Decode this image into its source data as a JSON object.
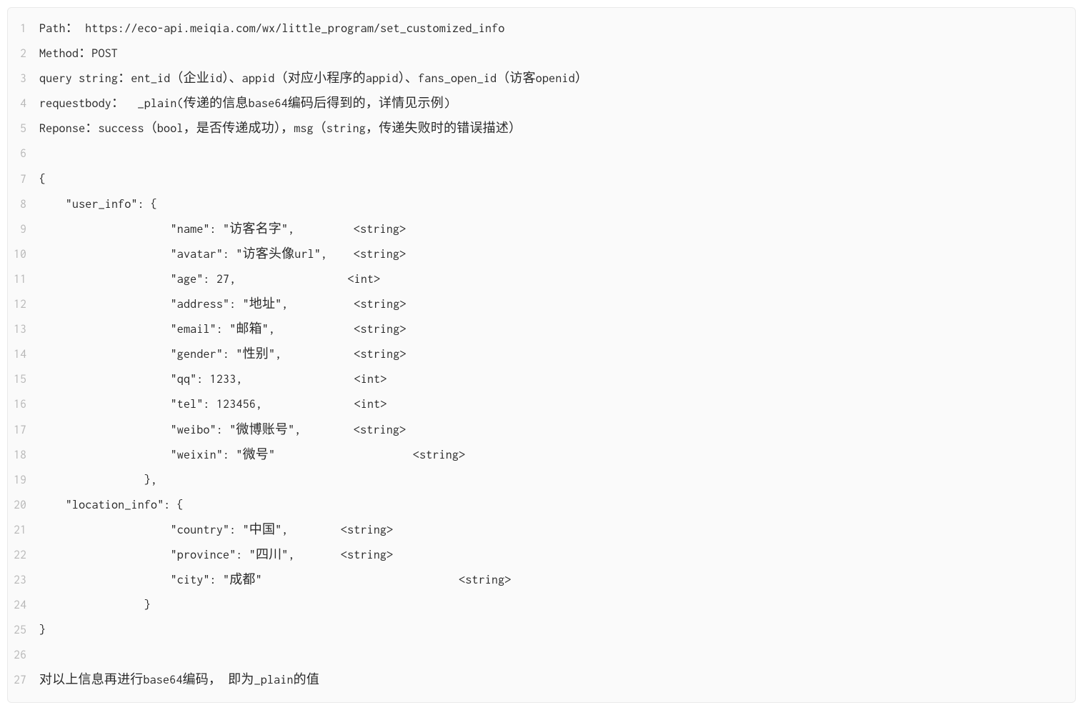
{
  "lines": [
    {
      "num": 1,
      "text": "Path： https://eco-api.meiqia.com/wx/little_program/set_customized_info"
    },
    {
      "num": 2,
      "text": "Method：POST"
    },
    {
      "num": 3,
      "text": "query string：ent_id（企业id）、appid（对应小程序的appid）、fans_open_id（访客openid）"
    },
    {
      "num": 4,
      "text": "requestbody：  _plain(传递的信息base64编码后得到的，详情见示例)"
    },
    {
      "num": 5,
      "text": "Reponse：success（bool，是否传递成功），msg（string，传递失败时的错误描述）"
    },
    {
      "num": 6,
      "text": ""
    },
    {
      "num": 7,
      "text": "{"
    },
    {
      "num": 8,
      "text": "    \"user_info\": {"
    },
    {
      "num": 9,
      "text": "                    \"name\": \"访客名字\",         <string>"
    },
    {
      "num": 10,
      "text": "                    \"avatar\": \"访客头像url\",    <string>"
    },
    {
      "num": 11,
      "text": "                    \"age\": 27,                 <int>"
    },
    {
      "num": 12,
      "text": "                    \"address\": \"地址\",          <string>"
    },
    {
      "num": 13,
      "text": "                    \"email\": \"邮箱\",            <string>"
    },
    {
      "num": 14,
      "text": "                    \"gender\": \"性别\",           <string>"
    },
    {
      "num": 15,
      "text": "                    \"qq\": 1233,                 <int>"
    },
    {
      "num": 16,
      "text": "                    \"tel\": 123456,              <int>"
    },
    {
      "num": 17,
      "text": "                    \"weibo\": \"微博账号\",        <string>"
    },
    {
      "num": 18,
      "text": "                    \"weixin\": \"微号\"                     <string>"
    },
    {
      "num": 19,
      "text": "                },"
    },
    {
      "num": 20,
      "text": "    \"location_info\": {"
    },
    {
      "num": 21,
      "text": "                    \"country\": \"中国\",        <string>"
    },
    {
      "num": 22,
      "text": "                    \"province\": \"四川\",       <string>"
    },
    {
      "num": 23,
      "text": "                    \"city\": \"成都\"                              <string>"
    },
    {
      "num": 24,
      "text": "                }"
    },
    {
      "num": 25,
      "text": "}"
    },
    {
      "num": 26,
      "text": ""
    },
    {
      "num": 27,
      "text": "对以上信息再进行base64编码， 即为_plain的值"
    }
  ]
}
